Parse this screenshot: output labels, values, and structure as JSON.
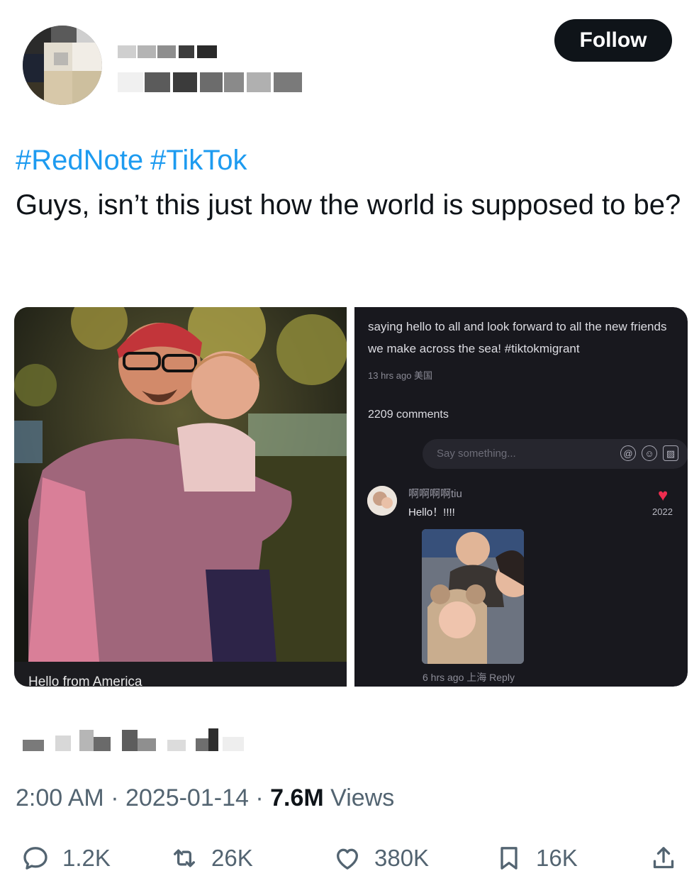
{
  "header": {
    "follow_label": "Follow",
    "avatar_icon": "pixelated-avatar",
    "name_icon": "pixelated-name",
    "handle_icon": "pixelated-handle"
  },
  "post": {
    "hashtags": [
      "#RedNote",
      "#TikTok"
    ],
    "text": "Guys, isn’t this just how the world is supposed to be?"
  },
  "media": {
    "photo_caption": "Hello from America",
    "screenshot": {
      "post_text": "saying hello to all and look forward to all the new friends we make across the sea! #tiktokmigrant",
      "post_time": "13 hrs ago 美国",
      "comments_count": "2209 comments",
      "input_placeholder": "Say something...",
      "comment": {
        "username": "啊啊啊啊tiu",
        "text": "Hello！!!!!",
        "likes": "2022",
        "footer": "6 hrs ago 上海 Reply"
      }
    }
  },
  "meta": {
    "time": "2:00 AM",
    "sep1": " · ",
    "date": "2025-01-14",
    "sep2": " · ",
    "views_count": "7.6M",
    "views_label": " Views"
  },
  "actions": {
    "replies": "1.2K",
    "reposts": "26K",
    "likes": "380K",
    "bookmarks": "16K"
  },
  "colors": {
    "accent": "#1d9bf0",
    "text": "#0f1419",
    "muted": "#536471",
    "dark_panel": "#18181e"
  }
}
